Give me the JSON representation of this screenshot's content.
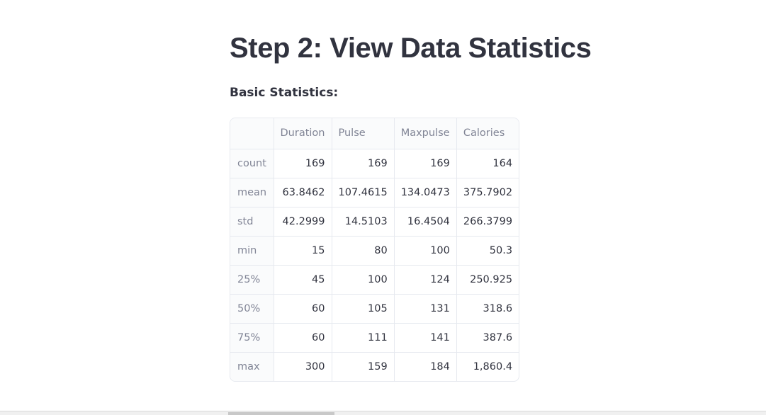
{
  "header": {
    "title": "Step 2: View Data Statistics",
    "subtitle": "Basic Statistics:"
  },
  "table": {
    "columns": [
      "",
      "Duration",
      "Pulse",
      "Maxpulse",
      "Calories"
    ],
    "rows": [
      {
        "label": "count",
        "values": [
          "169",
          "169",
          "169",
          "164"
        ]
      },
      {
        "label": "mean",
        "values": [
          "63.8462",
          "107.4615",
          "134.0473",
          "375.7902"
        ]
      },
      {
        "label": "std",
        "values": [
          "42.2999",
          "14.5103",
          "16.4504",
          "266.3799"
        ]
      },
      {
        "label": "min",
        "values": [
          "15",
          "80",
          "100",
          "50.3"
        ]
      },
      {
        "label": "25%",
        "values": [
          "45",
          "100",
          "124",
          "250.925"
        ]
      },
      {
        "label": "50%",
        "values": [
          "60",
          "105",
          "131",
          "318.6"
        ]
      },
      {
        "label": "75%",
        "values": [
          "60",
          "111",
          "141",
          "387.6"
        ]
      },
      {
        "label": "max",
        "values": [
          "300",
          "159",
          "184",
          "1,860.4"
        ]
      }
    ]
  }
}
